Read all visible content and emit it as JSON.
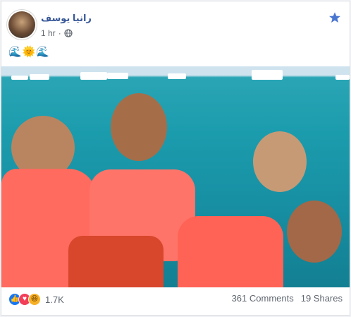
{
  "post": {
    "author": "رانيا يوسف",
    "timestamp": "1 hr",
    "audience_icon": "globe-icon",
    "header_action_icon": "star-icon",
    "text": "🌊🌞🌊"
  },
  "photo": {
    "alt": ""
  },
  "footer": {
    "reaction_icons": [
      "like-icon",
      "love-icon",
      "haha-icon"
    ],
    "reactions_count": "1.7K",
    "comments": "361 Comments",
    "shares": "19 Shares"
  },
  "colors": {
    "link_blue": "#385898",
    "like_blue": "#1877f2",
    "love_red": "#f33e58",
    "haha_yellow": "#f7b125",
    "secondary_text": "#616770"
  }
}
